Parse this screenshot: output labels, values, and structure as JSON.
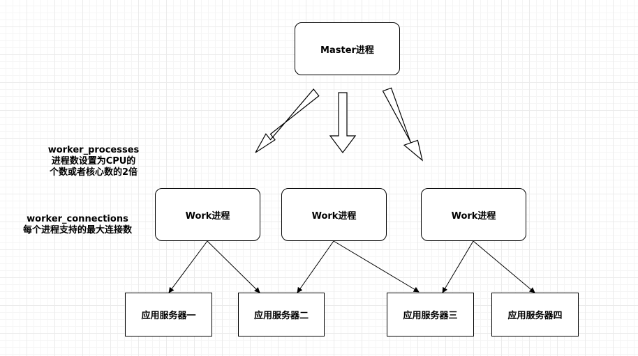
{
  "nodes": {
    "master": "Master进程",
    "workers": [
      "Work进程",
      "Work进程",
      "Work进程"
    ],
    "servers": [
      "应用服务器一",
      "应用服务器二",
      "应用服务器三",
      "应用服务器四"
    ]
  },
  "notes": {
    "processes": [
      "worker_processes",
      "进程数设置为CPU的",
      "个数或者核心数的2倍"
    ],
    "connections": [
      "worker_connections",
      "每个进程支持的最大连接数"
    ]
  },
  "colors": {
    "stroke": "#000000",
    "fill": "#ffffff",
    "grid": "#ebebeb"
  }
}
